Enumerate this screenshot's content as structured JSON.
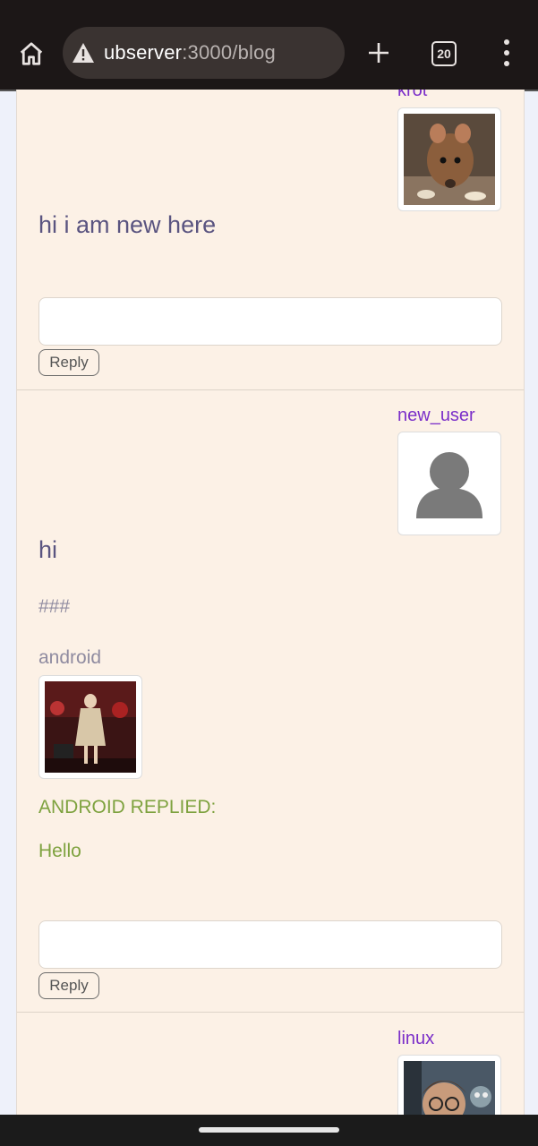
{
  "browser": {
    "url_host": "ubserver",
    "url_rest": ":3000/blog",
    "tab_count": "20"
  },
  "posts": [
    {
      "author": "krot",
      "title": "hi i am new here",
      "reply_label": "Reply"
    },
    {
      "author": "new_user",
      "title": "hi",
      "body_lines": [
        "###",
        "android"
      ],
      "reply_heading": "ANDROID REPLIED:",
      "reply_text": "Hello",
      "reply_label": "Reply"
    },
    {
      "author": "linux"
    }
  ],
  "colors": {
    "author": "#7b2fc9",
    "title": "#5a5480",
    "reply": "#7ea23f",
    "page_bg": "#fcf1e6"
  }
}
